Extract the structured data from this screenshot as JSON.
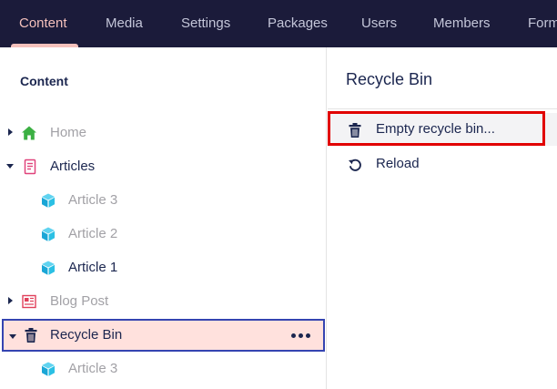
{
  "nav": {
    "tabs": [
      "Content",
      "Media",
      "Settings",
      "Packages",
      "Users",
      "Members",
      "Forms"
    ],
    "active": "Content"
  },
  "tree": {
    "title": "Content",
    "nodes": [
      {
        "label": "Home",
        "icon": "home-icon"
      },
      {
        "label": "Articles",
        "icon": "document-icon"
      },
      {
        "label": "Article 3",
        "icon": "cube-icon"
      },
      {
        "label": "Article 2",
        "icon": "cube-icon"
      },
      {
        "label": "Article 1",
        "icon": "cube-icon"
      },
      {
        "label": "Blog Post",
        "icon": "newspaper-icon"
      },
      {
        "label": "Recycle Bin",
        "icon": "trash-icon"
      },
      {
        "label": "Article 3",
        "icon": "cube-icon"
      }
    ]
  },
  "actions": {
    "title": "Recycle Bin",
    "items": [
      {
        "label": "Empty recycle bin...",
        "icon": "trash-icon"
      },
      {
        "label": "Reload",
        "icon": "reload-icon"
      }
    ]
  },
  "colors": {
    "nav_bg": "#1b1b3a",
    "nav_active": "#f5c1bc",
    "selected_bg": "#ffe1dd",
    "selected_border": "#3544b1",
    "highlight_border": "#e10000",
    "cube": "#2bc0e4",
    "home": "#3cb043"
  }
}
